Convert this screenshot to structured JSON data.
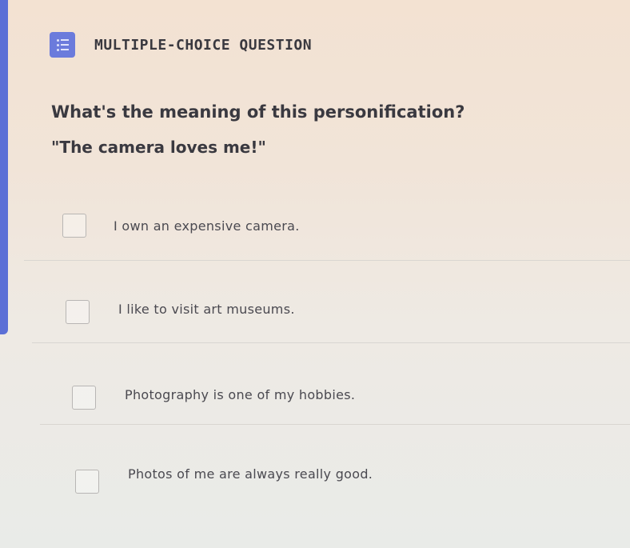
{
  "question": {
    "type_label": "MULTIPLE-CHOICE QUESTION",
    "type_icon": "list-icon",
    "prompt": "What's the meaning of this personification?",
    "quote": "\"The camera loves me!\""
  },
  "options": [
    {
      "label": "I own an expensive camera.",
      "checked": false
    },
    {
      "label": "I like to visit art museums.",
      "checked": false
    },
    {
      "label": "Photography is one of my hobbies.",
      "checked": false
    },
    {
      "label": "Photos of me are always really good.",
      "checked": false
    }
  ],
  "colors": {
    "accent": "#5b6fd6",
    "icon_bg": "#6b7bdc",
    "text": "#3a3940"
  }
}
